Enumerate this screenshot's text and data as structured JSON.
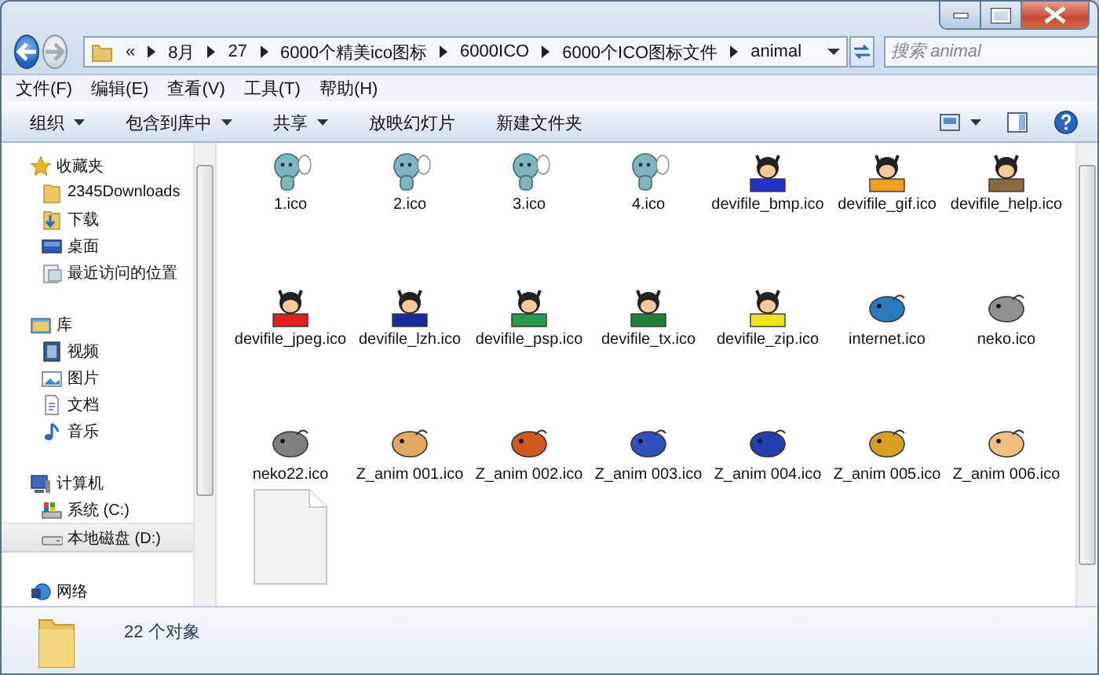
{
  "navigation": {
    "back": {
      "disabled": false
    },
    "forward": {
      "disabled": true
    }
  },
  "address_bar": {
    "overflow": "«",
    "path": [
      "8月",
      "27",
      "6000个精美ico图标",
      "6000ICO",
      "6000个ICO图标文件",
      "animal"
    ]
  },
  "search": {
    "placeholder": "搜索 animal"
  },
  "menu_bar": [
    "文件(F)",
    "编辑(E)",
    "查看(V)",
    "工具(T)",
    "帮助(H)"
  ],
  "toolbar": [
    {
      "label": "组织",
      "has_menu": true
    },
    {
      "label": "包含到库中",
      "has_menu": true
    },
    {
      "label": "共享",
      "has_menu": true
    },
    {
      "label": "放映幻灯片",
      "has_menu": false
    },
    {
      "label": "新建文件夹",
      "has_menu": false
    }
  ],
  "sidebar": {
    "groups": [
      {
        "label": "收藏夹",
        "kind": "star",
        "selected": false,
        "children": [
          {
            "label": "2345Downloads",
            "kind": "folder",
            "selected": false
          },
          {
            "label": "下载",
            "kind": "download",
            "selected": false
          },
          {
            "label": "桌面",
            "kind": "desktop",
            "selected": false
          },
          {
            "label": "最近访问的位置",
            "kind": "recent",
            "selected": false
          }
        ]
      },
      {
        "label": "库",
        "kind": "library",
        "selected": false,
        "children": [
          {
            "label": "视频",
            "kind": "video",
            "selected": false
          },
          {
            "label": "图片",
            "kind": "picture",
            "selected": false
          },
          {
            "label": "文档",
            "kind": "document",
            "selected": false
          },
          {
            "label": "音乐",
            "kind": "music",
            "selected": false
          }
        ]
      },
      {
        "label": "计算机",
        "kind": "computer",
        "selected": false,
        "children": [
          {
            "label": "系统 (C:)",
            "kind": "system-drive",
            "selected": false
          },
          {
            "label": "本地磁盘 (D:)",
            "kind": "drive",
            "selected": true
          }
        ]
      },
      {
        "label": "网络",
        "kind": "network",
        "selected": false
      }
    ]
  },
  "files": [
    {
      "name": "1.ico",
      "kind": "creature",
      "color": "#7fb6bd"
    },
    {
      "name": "2.ico",
      "kind": "creature",
      "color": "#7fb6bd"
    },
    {
      "name": "3.ico",
      "kind": "creature",
      "color": "#7fb6bd"
    },
    {
      "name": "4.ico",
      "kind": "creature",
      "color": "#7fb6bd"
    },
    {
      "name": "devifile_bmp.ico",
      "kind": "devil",
      "color": "#2233cc"
    },
    {
      "name": "devifile_gif.ico",
      "kind": "devil",
      "color": "#f0a020"
    },
    {
      "name": "devifile_help.ico",
      "kind": "devil",
      "color": "#8a6a40"
    },
    {
      "name": "devifile_jpeg.ico",
      "kind": "devil",
      "color": "#e02020"
    },
    {
      "name": "devifile_lzh.ico",
      "kind": "devil",
      "color": "#1a2aa0"
    },
    {
      "name": "devifile_psp.ico",
      "kind": "devil",
      "color": "#2a9a50"
    },
    {
      "name": "devifile_tx.ico",
      "kind": "devil",
      "color": "#208040"
    },
    {
      "name": "devifile_zip.ico",
      "kind": "devil",
      "color": "#f0e020"
    },
    {
      "name": "internet.ico",
      "kind": "animal",
      "color": "#2a7ac0"
    },
    {
      "name": "neko.ico",
      "kind": "animal",
      "color": "#909090"
    },
    {
      "name": "neko22.ico",
      "kind": "animal",
      "color": "#808080"
    },
    {
      "name": "Z_anim 001.ico",
      "kind": "animal",
      "color": "#e0a860"
    },
    {
      "name": "Z_anim 002.ico",
      "kind": "animal",
      "color": "#d05a20"
    },
    {
      "name": "Z_anim 003.ico",
      "kind": "animal",
      "color": "#3050c0"
    },
    {
      "name": "Z_anim 004.ico",
      "kind": "animal",
      "color": "#2040b0"
    },
    {
      "name": "Z_anim 005.ico",
      "kind": "animal",
      "color": "#d8a020"
    },
    {
      "name": "Z_anim 006.ico",
      "kind": "animal",
      "color": "#f0c080"
    },
    {
      "kind": "blank"
    }
  ],
  "status_bar": {
    "count": "22 个对象"
  }
}
